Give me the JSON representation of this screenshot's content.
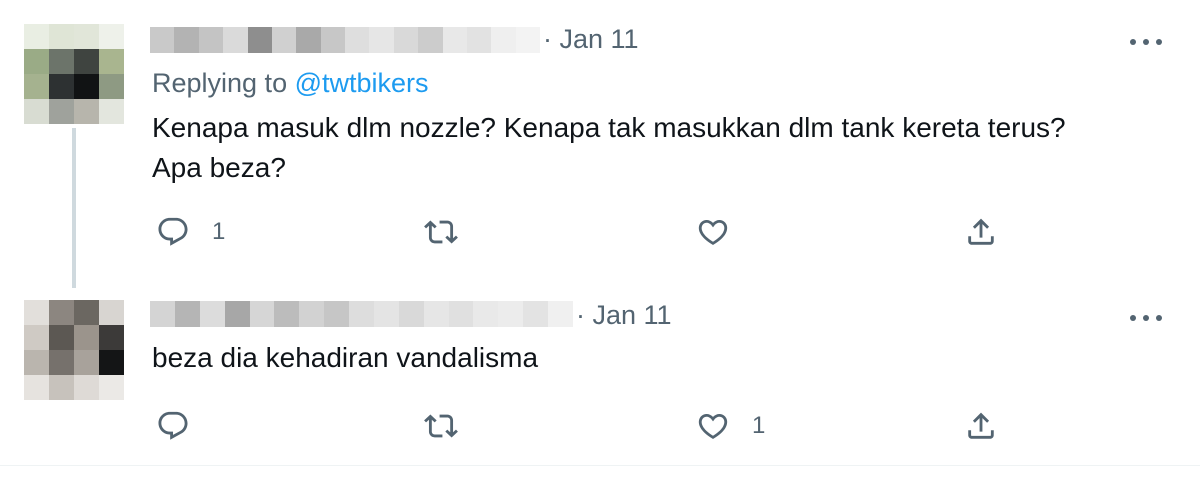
{
  "tweets": [
    {
      "date": "· Jan 11",
      "replying_prefix": "Replying to ",
      "replying_handle": "@twtbikers",
      "text": "Kenapa masuk dlm nozzle? Kenapa tak masukkan dlm tank kereta terus?\nApa beza?",
      "reply_count": "1",
      "retweet_count": "",
      "like_count": "",
      "icons": {
        "reply": "reply-icon",
        "retweet": "retweet-icon",
        "like": "heart-icon",
        "share": "share-icon",
        "more": "more-icon"
      }
    },
    {
      "date": "· Jan 11",
      "text": "beza dia kehadiran vandalisma",
      "reply_count": "",
      "retweet_count": "",
      "like_count": "1",
      "icons": {
        "reply": "reply-icon",
        "retweet": "retweet-icon",
        "like": "heart-icon",
        "share": "share-icon",
        "more": "more-icon"
      }
    }
  ],
  "colors": {
    "text": "#0f1419",
    "secondary": "#536471",
    "link": "#1d9bf0",
    "thread_line": "#cfd9de",
    "divider": "#eff3f4"
  }
}
